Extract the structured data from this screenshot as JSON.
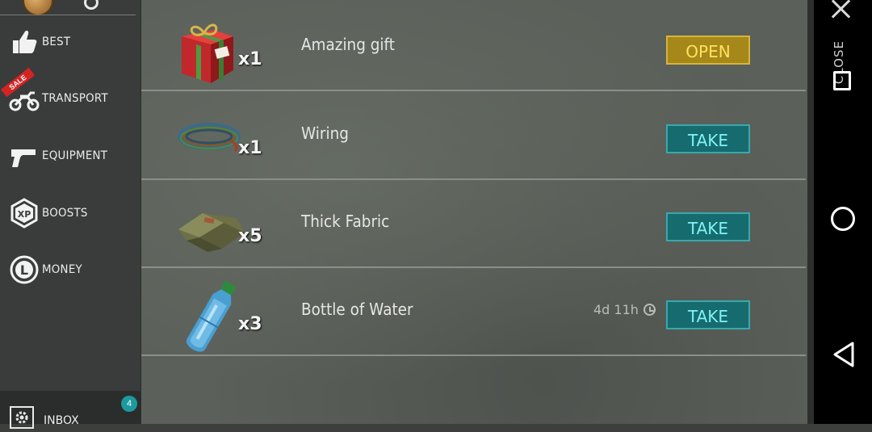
{
  "sidebar": {
    "items": [
      {
        "label": "BEST",
        "icon": "thumbs-up-icon"
      },
      {
        "label": "TRANSPORT",
        "icon": "motorcycle-icon",
        "sale_tag": "SALE"
      },
      {
        "label": "EQUIPMENT",
        "icon": "pistol-icon"
      },
      {
        "label": "BOOSTS",
        "icon": "xp-hexagon-icon",
        "icon_text": "XP"
      },
      {
        "label": "MONEY",
        "icon": "coin-icon",
        "icon_text": "L"
      }
    ],
    "inbox": {
      "label": "INBOX",
      "badge": "4",
      "icon": "gear-icon"
    }
  },
  "items": [
    {
      "name": "Amazing gift",
      "qty": "x1",
      "button": "OPEN",
      "icon": "gift-box-icon"
    },
    {
      "name": "Wiring",
      "qty": "x1",
      "button": "TAKE",
      "icon": "wire-coil-icon"
    },
    {
      "name": "Thick Fabric",
      "qty": "x5",
      "button": "TAKE",
      "icon": "fabric-icon"
    },
    {
      "name": "Bottle of Water",
      "qty": "x3",
      "button": "TAKE",
      "timer": "4d 11h",
      "icon": "water-bottle-icon"
    }
  ],
  "close": {
    "label": "CLOSE"
  },
  "colors": {
    "open_button": "#a6871a",
    "take_button": "#166b6e",
    "sale_tag": "#d32424",
    "badge": "#1c9a9e"
  }
}
